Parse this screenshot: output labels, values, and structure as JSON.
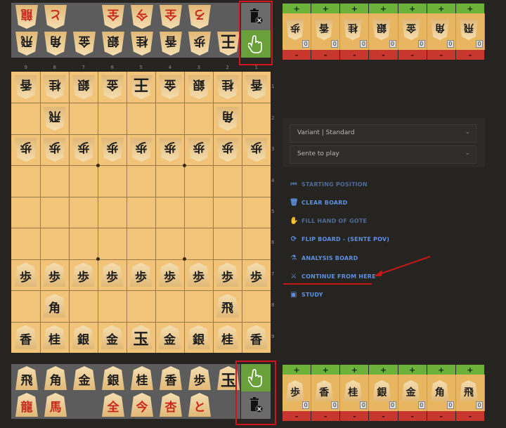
{
  "gote_palette": {
    "row1": [
      {
        "k": "龍",
        "p": true
      },
      {
        "k": "と",
        "p": true
      },
      {
        "k": "",
        "p": false
      },
      {
        "k": "全",
        "p": true
      },
      {
        "k": "今",
        "p": true
      },
      {
        "k": "全",
        "p": true
      },
      {
        "k": "ろ",
        "p": true
      },
      {
        "k": "",
        "p": false
      }
    ],
    "row2": [
      {
        "k": "飛",
        "p": false
      },
      {
        "k": "角",
        "p": false
      },
      {
        "k": "金",
        "p": false
      },
      {
        "k": "銀",
        "p": false
      },
      {
        "k": "桂",
        "p": false
      },
      {
        "k": "香",
        "p": false
      },
      {
        "k": "歩",
        "p": false
      },
      {
        "k": "王",
        "p": false
      }
    ]
  },
  "sente_palette": {
    "row1": [
      {
        "k": "飛",
        "p": false
      },
      {
        "k": "角",
        "p": false
      },
      {
        "k": "金",
        "p": false
      },
      {
        "k": "銀",
        "p": false
      },
      {
        "k": "桂",
        "p": false
      },
      {
        "k": "香",
        "p": false
      },
      {
        "k": "歩",
        "p": false
      },
      {
        "k": "玉",
        "p": false
      }
    ],
    "row2": [
      {
        "k": "龍",
        "p": true
      },
      {
        "k": "馬",
        "p": true
      },
      {
        "k": "",
        "p": false
      },
      {
        "k": "全",
        "p": true
      },
      {
        "k": "今",
        "p": true
      },
      {
        "k": "杏",
        "p": true
      },
      {
        "k": "と",
        "p": true
      },
      {
        "k": "",
        "p": false
      }
    ]
  },
  "tools": {
    "trash_icon": "trash-icon",
    "hand_icon": "hand-pointer-icon"
  },
  "gote_pocket": {
    "pieces": [
      "歩",
      "香",
      "桂",
      "銀",
      "金",
      "角",
      "飛"
    ],
    "counts": [
      "0",
      "0",
      "0",
      "0",
      "0",
      "0",
      "0"
    ],
    "plus": "+",
    "minus": "-"
  },
  "sente_pocket": {
    "pieces": [
      "歩",
      "香",
      "桂",
      "銀",
      "金",
      "角",
      "飛"
    ],
    "counts": [
      "0",
      "0",
      "0",
      "0",
      "0",
      "0",
      "0"
    ],
    "plus": "+",
    "minus": "-"
  },
  "board": {
    "files": [
      "9",
      "8",
      "7",
      "6",
      "5",
      "4",
      "3",
      "2",
      "1"
    ],
    "ranks": [
      "1",
      "2",
      "3",
      "4",
      "5",
      "6",
      "7",
      "8",
      "9"
    ],
    "rows": [
      [
        {
          "k": "香",
          "o": "g"
        },
        {
          "k": "桂",
          "o": "g"
        },
        {
          "k": "銀",
          "o": "g"
        },
        {
          "k": "金",
          "o": "g"
        },
        {
          "k": "王",
          "o": "g"
        },
        {
          "k": "金",
          "o": "g"
        },
        {
          "k": "銀",
          "o": "g"
        },
        {
          "k": "桂",
          "o": "g"
        },
        {
          "k": "香",
          "o": "g"
        }
      ],
      [
        null,
        {
          "k": "飛",
          "o": "g"
        },
        null,
        null,
        null,
        null,
        null,
        {
          "k": "角",
          "o": "g"
        },
        null
      ],
      [
        {
          "k": "歩",
          "o": "g"
        },
        {
          "k": "歩",
          "o": "g"
        },
        {
          "k": "歩",
          "o": "g"
        },
        {
          "k": "歩",
          "o": "g"
        },
        {
          "k": "歩",
          "o": "g"
        },
        {
          "k": "歩",
          "o": "g"
        },
        {
          "k": "歩",
          "o": "g"
        },
        {
          "k": "歩",
          "o": "g"
        },
        {
          "k": "歩",
          "o": "g"
        }
      ],
      [
        null,
        null,
        null,
        null,
        null,
        null,
        null,
        null,
        null
      ],
      [
        null,
        null,
        null,
        null,
        null,
        null,
        null,
        null,
        null
      ],
      [
        null,
        null,
        null,
        null,
        null,
        null,
        null,
        null,
        null
      ],
      [
        {
          "k": "歩",
          "o": "s"
        },
        {
          "k": "歩",
          "o": "s"
        },
        {
          "k": "歩",
          "o": "s"
        },
        {
          "k": "歩",
          "o": "s"
        },
        {
          "k": "歩",
          "o": "s"
        },
        {
          "k": "歩",
          "o": "s"
        },
        {
          "k": "歩",
          "o": "s"
        },
        {
          "k": "歩",
          "o": "s"
        },
        {
          "k": "歩",
          "o": "s"
        }
      ],
      [
        null,
        {
          "k": "角",
          "o": "s"
        },
        null,
        null,
        null,
        null,
        null,
        {
          "k": "飛",
          "o": "s"
        },
        null
      ],
      [
        {
          "k": "香",
          "o": "s"
        },
        {
          "k": "桂",
          "o": "s"
        },
        {
          "k": "銀",
          "o": "s"
        },
        {
          "k": "金",
          "o": "s"
        },
        {
          "k": "玉",
          "o": "s"
        },
        {
          "k": "金",
          "o": "s"
        },
        {
          "k": "銀",
          "o": "s"
        },
        {
          "k": "桂",
          "o": "s"
        },
        {
          "k": "香",
          "o": "s"
        }
      ]
    ]
  },
  "controls": {
    "variant_select": "Variant | Standard",
    "turn_select": "Sente to play",
    "actions": [
      {
        "label": "STARTING POSITION",
        "icon": "skip-back-icon",
        "glyph": "⏮",
        "enabled": false
      },
      {
        "label": "CLEAR BOARD",
        "icon": "trash-icon",
        "glyph": "🗑",
        "enabled": true
      },
      {
        "label": "FILL HAND OF GOTE",
        "icon": "fill-hand-icon",
        "glyph": "✋",
        "enabled": false
      },
      {
        "label": "FLIP BOARD - (SENTE POV)",
        "icon": "flip-icon",
        "glyph": "⟳",
        "enabled": true
      },
      {
        "label": "ANALYSIS BOARD",
        "icon": "flask-icon",
        "glyph": "⚗",
        "enabled": true
      },
      {
        "label": "CONTINUE FROM HERE",
        "icon": "swords-icon",
        "glyph": "⚔",
        "enabled": true
      },
      {
        "label": "STUDY",
        "icon": "study-icon",
        "glyph": "▣",
        "enabled": true
      }
    ]
  }
}
